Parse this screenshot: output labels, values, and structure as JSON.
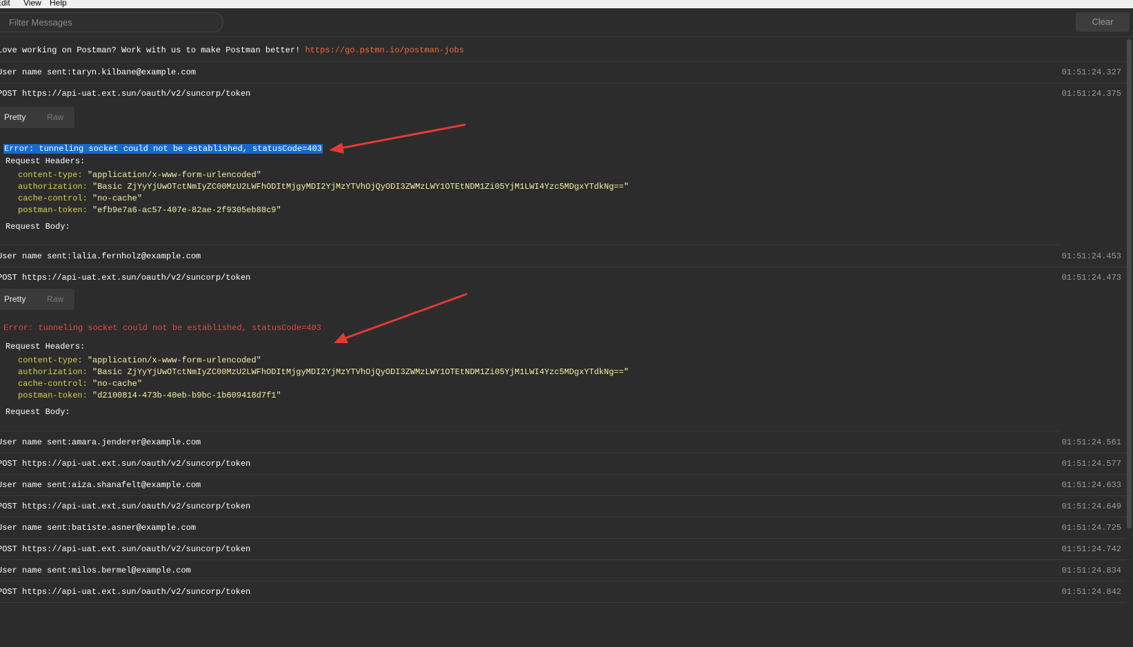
{
  "menu": {
    "items": [
      "Edit",
      "View",
      "Help"
    ]
  },
  "filter": {
    "placeholder": "Filter Messages"
  },
  "clear_button": "Clear",
  "promo": {
    "text": "Love working on Postman? Work with us to make Postman better!",
    "link": "https://go.pstmn.io/postman-jobs"
  },
  "entries": [
    {
      "msg": "User name sent:taryn.kilbane@example.com",
      "ts": "01:51:24.327"
    },
    {
      "msg": "POST  https://api-uat.ext.sun/oauth/v2/suncorp/token",
      "ts": "01:51:24.375"
    },
    {
      "msg": "User name sent:lalia.fernholz@example.com",
      "ts": "01:51:24.453"
    },
    {
      "msg": "POST  https://api-uat.ext.sun/oauth/v2/suncorp/token",
      "ts": "01:51:24.473"
    },
    {
      "msg": "User name sent:amara.jenderer@example.com",
      "ts": "01:51:24.561"
    },
    {
      "msg": "POST  https://api-uat.ext.sun/oauth/v2/suncorp/token",
      "ts": "01:51:24.577"
    },
    {
      "msg": "User name sent:aiza.shanafelt@example.com",
      "ts": "01:51:24.633"
    },
    {
      "msg": "POST  https://api-uat.ext.sun/oauth/v2/suncorp/token",
      "ts": "01:51:24.649"
    },
    {
      "msg": "User name sent:batiste.asner@example.com",
      "ts": "01:51:24.725"
    },
    {
      "msg": "POST  https://api-uat.ext.sun/oauth/v2/suncorp/token",
      "ts": "01:51:24.742"
    },
    {
      "msg": "User name sent:milos.bermel@example.com",
      "ts": "01:51:24.834"
    },
    {
      "msg": "POST  https://api-uat.ext.sun/oauth/v2/suncorp/token",
      "ts": "01:51:24.842"
    }
  ],
  "details": [
    {
      "tab_pretty": "Pretty",
      "tab_raw": "Raw",
      "error": "Error: tunneling socket could not be established, statusCode=403",
      "headers_label": "Request Headers:",
      "headers": [
        {
          "key": "content-type:",
          "value": "\"application/x-www-form-urlencoded\""
        },
        {
          "key": "authorization:",
          "value": "\"Basic ZjYyYjUwOTctNmIyZC00MzU2LWFhODItMjgyMDI2YjMzYTVhOjQyODI3ZWMzLWY1OTEtNDM1Zi05YjM1LWI4Yzc5MDgxYTdkNg==\""
        },
        {
          "key": "cache-control:",
          "value": "\"no-cache\""
        },
        {
          "key": "postman-token:",
          "value": "\"efb9e7a6-ac57-407e-82ae-2f9305eb88c9\""
        }
      ],
      "body_label": "Request Body:"
    },
    {
      "tab_pretty": "Pretty",
      "tab_raw": "Raw",
      "error": "Error: tunneling socket could not be established, statusCode=403",
      "headers_label": "Request Headers:",
      "headers": [
        {
          "key": "content-type:",
          "value": "\"application/x-www-form-urlencoded\""
        },
        {
          "key": "authorization:",
          "value": "\"Basic ZjYyYjUwOTctNmIyZC00MzU2LWFhODItMjgyMDI2YjMzYTVhOjQyODI3ZWMzLWY1OTEtNDM1Zi05YjM1LWI4Yzc5MDgxYTdkNg==\""
        },
        {
          "key": "cache-control:",
          "value": "\"no-cache\""
        },
        {
          "key": "postman-token:",
          "value": "\"d2100814-473b-40eb-b9bc-1b609418d7f1\""
        }
      ],
      "body_label": "Request Body:"
    }
  ],
  "colors": {
    "background": "#2c2c2c",
    "link": "#f26b3a",
    "error": "#ef4444",
    "selection": "#1769d0",
    "header_key": "#d8d04a",
    "header_value": "#f5f0a6",
    "annotation_arrow": "#e53935"
  }
}
